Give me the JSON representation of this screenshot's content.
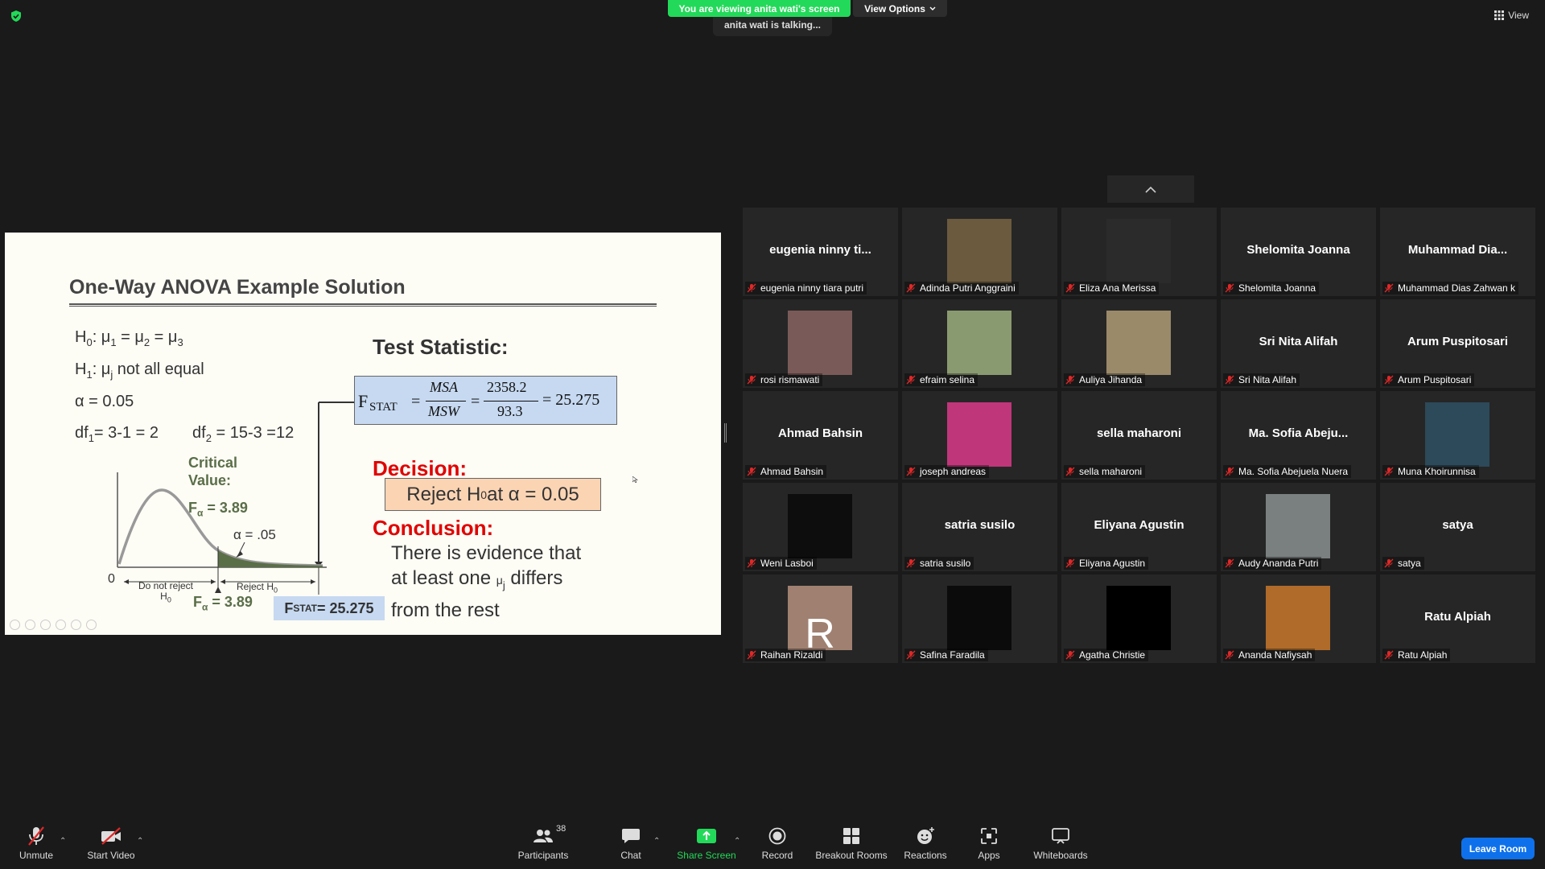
{
  "top": {
    "viewing_banner": "You are viewing anita wati's screen",
    "view_options": "View Options",
    "talking": "anita wati is talking...",
    "view_label": "View"
  },
  "slide": {
    "title": "One-Way ANOVA Example Solution",
    "h0_label": "H",
    "h0_text": ": μ",
    "h1_text": ": μ",
    "h1_rest": " not all equal",
    "alpha": "α = 0.05",
    "df1": "df",
    "df1_rest": "= 3-1 = 2",
    "df2": "df",
    "df2_rest": " = 15-3 =12",
    "test_statistic": "Test Statistic:",
    "formula": {
      "f": "F",
      "stat": "STAT",
      "msa": "MSA",
      "msw": "MSW",
      "num": "2358.2",
      "den": "93.3",
      "result": "= 25.275"
    },
    "critical_value": "Critical Value:",
    "f_alpha": "F",
    "f_alpha_value": " = 3.89",
    "alpha_region": "α = .05",
    "zero": "0",
    "do_not_reject": "Do not reject H",
    "reject_h": "Reject H",
    "fstat_box": "F",
    "fstat_value": " = 25.275",
    "decision_label": "Decision:",
    "decision_text": "Reject H",
    "decision_text_rest": " at α = 0.05",
    "conclusion_label": "Conclusion:",
    "conclusion_1": "There is evidence that",
    "conclusion_2a": "at least one ",
    "conclusion_2b": " differs",
    "conclusion_3": "from the rest",
    "mu_j": "μ",
    "j": "j"
  },
  "participants": [
    {
      "name": "eugenia ninny tiara putri",
      "display": "eugenia  ninny  ti...",
      "thumb": null
    },
    {
      "name": "Adinda Putri Anggraini",
      "display": null,
      "thumb": "#6b5a3e"
    },
    {
      "name": "Eliza Ana Merissa",
      "display": null,
      "thumb": "#2b2b2b"
    },
    {
      "name": "Shelomita Joanna",
      "display": "Shelomita Joanna",
      "thumb": null
    },
    {
      "name": "Muhammad Dias Zahwan k",
      "display": "Muhammad  Dia...",
      "thumb": null
    },
    {
      "name": "rosi rismawati",
      "display": null,
      "thumb": "#7a5a58"
    },
    {
      "name": "efraim selina",
      "display": null,
      "thumb": "#8a9a70"
    },
    {
      "name": "Auliya Jihanda",
      "display": null,
      "thumb": "#9a8a6a"
    },
    {
      "name": "Sri Nita Alifah",
      "display": "Sri Nita Alifah",
      "thumb": null
    },
    {
      "name": "Arum Puspitosari",
      "display": "Arum Puspitosari",
      "thumb": null
    },
    {
      "name": "Ahmad Bahsin",
      "display": "Ahmad Bahsin",
      "thumb": null
    },
    {
      "name": "joseph andreas",
      "display": null,
      "thumb": "#c0367a"
    },
    {
      "name": "sella maharoni",
      "display": "sella maharoni",
      "thumb": null
    },
    {
      "name": "Ma. Sofia Abejuela Nuera",
      "display": "Ma.  Sofia  Abeju...",
      "thumb": null
    },
    {
      "name": "Muna Khoirunnisa",
      "display": null,
      "thumb": "#2d4a5a"
    },
    {
      "name": "Weni Lasboi",
      "display": null,
      "thumb": "#0d0d0d"
    },
    {
      "name": "satria susilo",
      "display": "satria susilo",
      "thumb": null
    },
    {
      "name": "Eliyana Agustin",
      "display": "Eliyana Agustin",
      "thumb": null
    },
    {
      "name": "Audy Ananda Putri",
      "display": null,
      "thumb": "#7a8080"
    },
    {
      "name": "satya",
      "display": "satya",
      "thumb": null
    },
    {
      "name": "Raihan Rizaldi",
      "display": null,
      "thumb": "#a08070",
      "thumb_letter": "R"
    },
    {
      "name": "Safina Faradila",
      "display": null,
      "thumb": "#0b0b0b"
    },
    {
      "name": "Agatha Christie",
      "display": null,
      "thumb": "#000000"
    },
    {
      "name": "Ananda Nafiysah",
      "display": null,
      "thumb": "#b06a2a"
    },
    {
      "name": "Ratu Alpiah",
      "display": "Ratu Alpiah",
      "thumb": null
    }
  ],
  "toolbar": {
    "unmute": "Unmute",
    "start_video": "Start Video",
    "participants": "Participants",
    "participant_count": "38",
    "chat": "Chat",
    "share_screen": "Share Screen",
    "record": "Record",
    "breakout_rooms": "Breakout Rooms",
    "reactions": "Reactions",
    "apps": "Apps",
    "whiteboards": "Whiteboards",
    "leave_room": "Leave Room"
  },
  "colors": {
    "banner_green": "#23d959",
    "leave_blue": "#0e71eb",
    "mic_red": "#e02828",
    "decision_red": "#e00000",
    "formula_blue": "#c6d9f1",
    "reject_peach": "#fbd4b4"
  },
  "icons": [
    "shield-check-icon",
    "chevron-down-icon",
    "grid-view-icon",
    "chevron-up-icon",
    "mic-muted-icon",
    "video-off-icon",
    "participants-icon",
    "chat-icon",
    "share-screen-icon",
    "record-icon",
    "breakout-rooms-icon",
    "reactions-icon",
    "apps-icon",
    "whiteboard-icon"
  ]
}
